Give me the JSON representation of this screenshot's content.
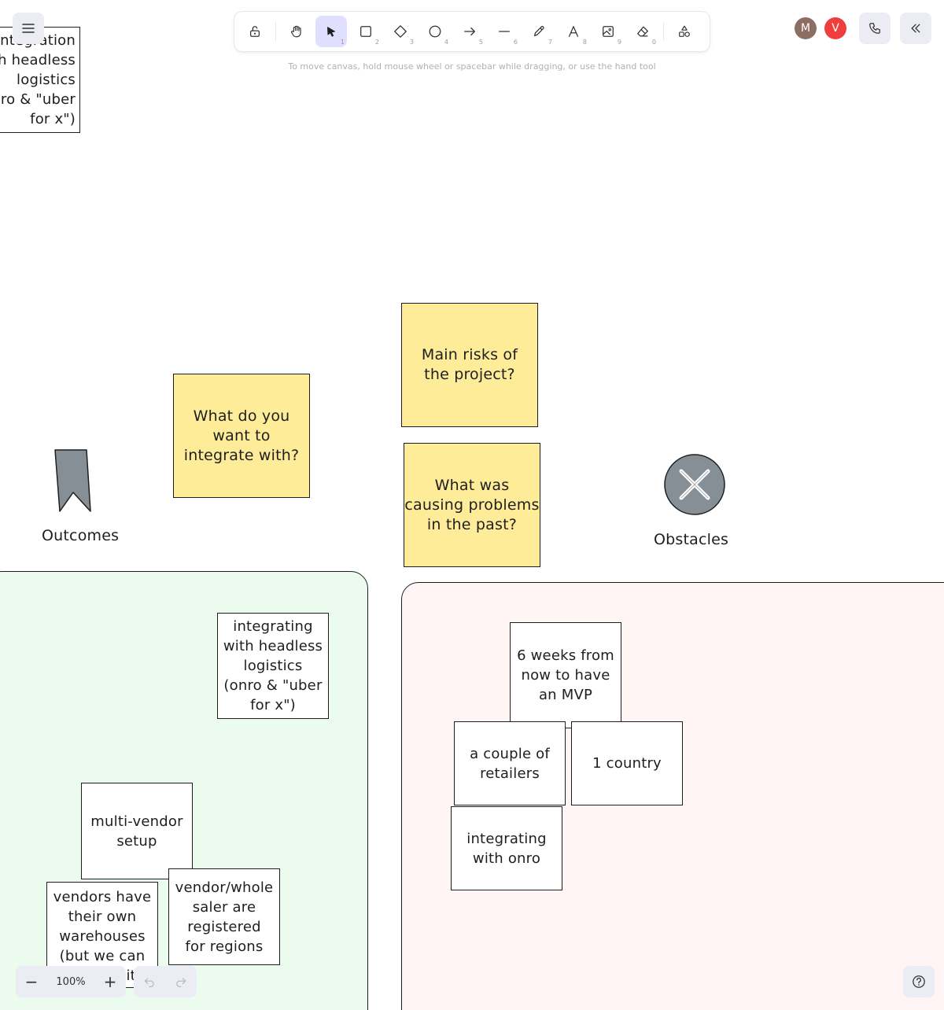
{
  "toolbar": {
    "hint": "To move canvas, hold mouse wheel or spacebar while dragging, or use the hand tool",
    "tools": [
      {
        "name": "lock",
        "key": ""
      },
      {
        "name": "hand",
        "key": ""
      },
      {
        "name": "selection",
        "key": "1",
        "active": true
      },
      {
        "name": "rectangle",
        "key": "2"
      },
      {
        "name": "diamond",
        "key": "3"
      },
      {
        "name": "ellipse",
        "key": "4"
      },
      {
        "name": "arrow",
        "key": "5"
      },
      {
        "name": "line",
        "key": "6"
      },
      {
        "name": "draw",
        "key": "7"
      },
      {
        "name": "text",
        "key": "8"
      },
      {
        "name": "image",
        "key": "9"
      },
      {
        "name": "eraser",
        "key": "0"
      },
      {
        "name": "more-shapes",
        "key": ""
      }
    ]
  },
  "collaborators": [
    {
      "initial": "M",
      "color": "#8d6e63"
    },
    {
      "initial": "V",
      "color": "#f03e3e"
    }
  ],
  "canvas": {
    "top_left_note": "integration\nwith headless\nlogistics\n(onro & \"uber\nfor x\")",
    "sticky_integrate": "What do you\nwant to\nintegrate with?",
    "sticky_risks": "Main risks of\nthe project?",
    "sticky_problems": "What was\ncausing problems\nin the past?",
    "label_outcomes": "Outcomes",
    "label_obstacles": "Obstacles",
    "outcomes_notes": [
      "integrating\nwith headless\nlogistics\n(onro & \"uber\nfor x\")",
      "multi-vendor\nsetup",
      "vendors have\ntheir own\nwarehouses\n(but we can\nmanage it)",
      "vendor/whole\nsaler are\nregistered\nfor regions"
    ],
    "obstacles_notes": [
      "6 weeks from\nnow to have\nan MVP",
      "a couple of\nretailers",
      "1 country",
      "integrating\nwith onro"
    ]
  },
  "colors": {
    "sticky": "#ffec99",
    "outcomes_frame": "#ebfbee",
    "obstacles_frame": "#fff5f5",
    "active_tool": "#e0dfff",
    "icon_gray": "#868e96"
  },
  "footer": {
    "zoom": "100%",
    "zoom_out": "−",
    "zoom_in": "+"
  }
}
